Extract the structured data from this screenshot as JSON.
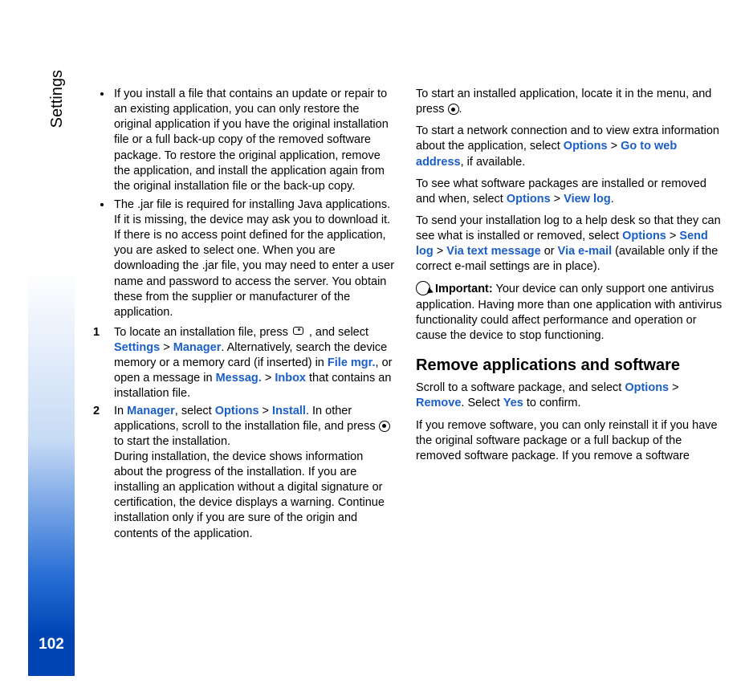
{
  "sidebar": {
    "section_label": "Settings",
    "page_number": "102"
  },
  "bullets": {
    "b1": "If you install a file that contains an update or repair to an existing application, you can only restore the original application if you have the original installation file or a full back-up copy of the removed software package. To restore the original application, remove the application, and install the application again from the original installation file or the back-up copy.",
    "b2": "The .jar file is required for installing Java applications. If it is missing, the device may ask you to download it. If there is no access point defined for the application, you are asked to select one. When you are downloading the .jar file, you may need to enter a user name and password to access the server. You obtain these from the supplier or manufacturer of the application."
  },
  "steps": {
    "s1_a": "To locate an installation file, press ",
    "s1_b": " , and select ",
    "s1_settings": "Settings",
    "s1_gt1": " > ",
    "s1_manager": "Manager",
    "s1_c": ". Alternatively, search the device memory or a memory card (if inserted) in ",
    "s1_filemgr": "File mgr.",
    "s1_d": ", or open a message in ",
    "s1_messag": "Messag.",
    "s1_gt2": " > ",
    "s1_inbox": "Inbox",
    "s1_e": " that contains an installation file.",
    "s2_a": "In ",
    "s2_manager": "Manager",
    "s2_b": ", select ",
    "s2_options": "Options",
    "s2_gt1": " > ",
    "s2_install": "Install",
    "s2_c": ". In other applications, scroll to the installation file, and press ",
    "s2_d": " to start the installation.",
    "s2_e": "During installation, the device shows information about the progress of the installation. If you are installing an application without a digital signature or certification, the device displays a warning. Continue installation only if you are sure of the origin and contents of the application."
  },
  "paras": {
    "p1_a": "To start an installed application, locate it in the menu, and press ",
    "p1_b": ".",
    "p2_a": "To start a network connection and to view extra information about the application, select ",
    "p2_options": "Options",
    "p2_gt": " > ",
    "p2_goto": "Go to web address",
    "p2_b": ", if available.",
    "p3_a": "To see what software packages are installed or removed and when, select ",
    "p3_options": "Options",
    "p3_gt": " > ",
    "p3_viewlog": "View log",
    "p3_b": ".",
    "p4_a": "To send your installation log to a help desk so that they can see what is installed or removed, select ",
    "p4_options": "Options",
    "p4_gt1": " > ",
    "p4_sendlog": "Send log",
    "p4_gt2": " > ",
    "p4_viatext": "Via text message",
    "p4_or": " or ",
    "p4_viaemail": "Via e-mail",
    "p4_b": " (available only if the correct e-mail settings are in place).",
    "p5_label": "Important:",
    "p5_body": " Your device can only support one antivirus application. Having more than one application with antivirus functionality could affect performance and operation or cause the device to stop functioning."
  },
  "heading": "Remove applications and software",
  "remove": {
    "r1_a": "Scroll to a software package, and select ",
    "r1_options": "Options",
    "r1_gt": " > ",
    "r1_remove": "Remove",
    "r1_b": ". Select ",
    "r1_yes": "Yes",
    "r1_c": " to confirm.",
    "r2": "If you remove software, you can only reinstall it if you have the original software package or a full backup of the removed software package. If you remove a software"
  }
}
